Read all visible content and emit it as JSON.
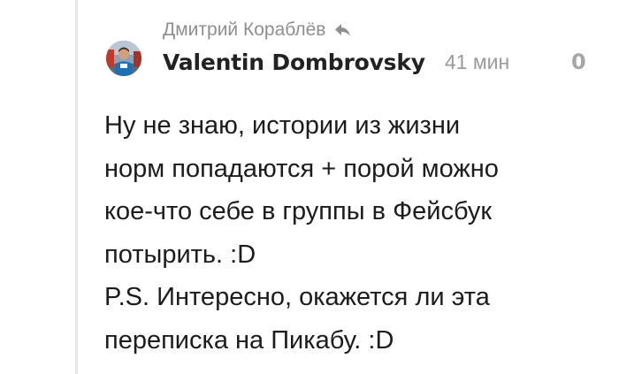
{
  "comment": {
    "reply_to_name": "Дмитрий Кораблёв",
    "author": "Valentin Dombrovsky",
    "time": "41 мин",
    "rating": "0",
    "text_lines": [
      "Ну не знаю, истории из жизни",
      "норм попадаются + порой можно",
      "кое-что себе в группы в Фейсбук",
      "потырить. :D",
      "P.S. Интересно, окажется ли эта",
      "переписка на Пикабу. :D"
    ]
  },
  "icons": {
    "reply": "reply-arrow-icon",
    "avatar": "user-avatar-photo"
  },
  "colors": {
    "author": "#222222",
    "meta": "#8f8f8f",
    "rating": "#a6a6a6",
    "text": "#1c1c1c",
    "thread_line": "#e5e5e5"
  }
}
